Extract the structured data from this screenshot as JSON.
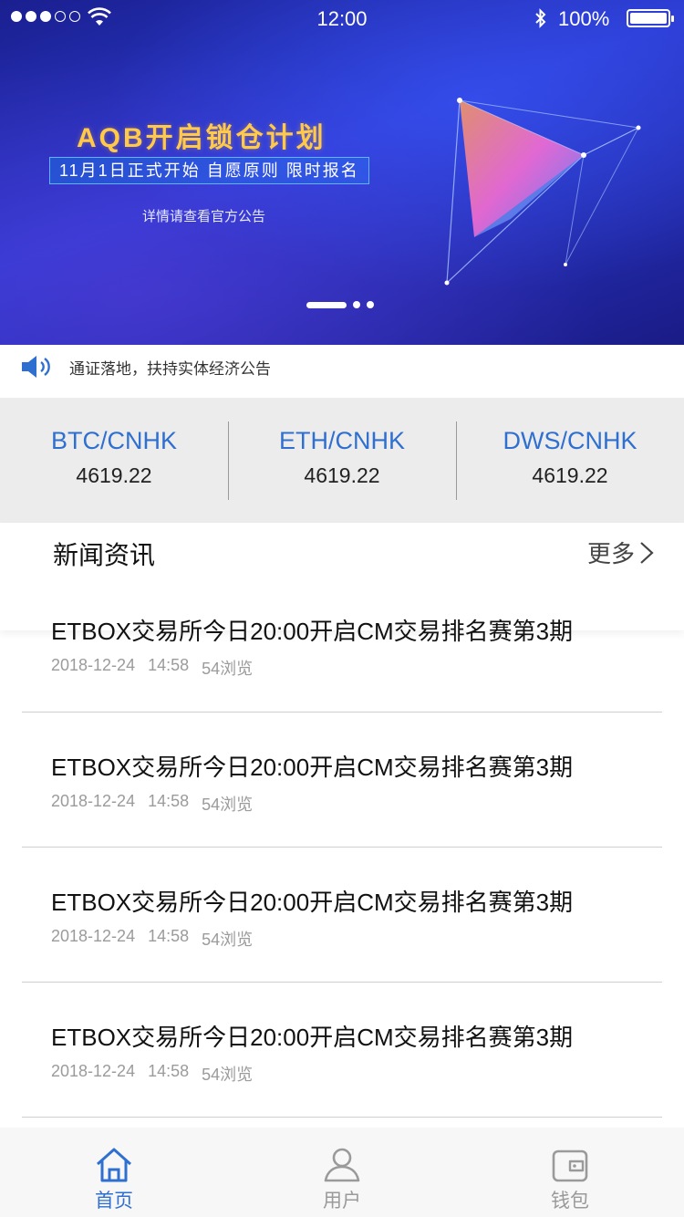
{
  "status_bar": {
    "time": "12:00",
    "battery": "100%"
  },
  "banner": {
    "title": "AQB开启锁仓计划",
    "subtitle": "11月1日正式开始 自愿原则 限时报名",
    "note": "详情请查看官方公告",
    "page_count": 3,
    "active_page": 1
  },
  "notice": {
    "text": "通证落地，扶持实体经济公告"
  },
  "tickers": [
    {
      "pair": "BTC/CNHK",
      "price": "4619.22"
    },
    {
      "pair": "ETH/CNHK",
      "price": "4619.22"
    },
    {
      "pair": "DWS/CNHK",
      "price": "4619.22"
    }
  ],
  "news": {
    "title": "新闻资讯",
    "more_label": "更多",
    "items": [
      {
        "headline": "ETBOX交易所今日20:00开启CM交易排名赛第3期",
        "date": "2018-12-24",
        "time": "14:58",
        "views": "54浏览"
      },
      {
        "headline": "ETBOX交易所今日20:00开启CM交易排名赛第3期",
        "date": "2018-12-24",
        "time": "14:58",
        "views": "54浏览"
      },
      {
        "headline": "ETBOX交易所今日20:00开启CM交易排名赛第3期",
        "date": "2018-12-24",
        "time": "14:58",
        "views": "54浏览"
      },
      {
        "headline": "ETBOX交易所今日20:00开启CM交易排名赛第3期",
        "date": "2018-12-24",
        "time": "14:58",
        "views": "54浏览"
      }
    ]
  },
  "tabbar": {
    "items": [
      {
        "label": "首页",
        "icon": "home-icon",
        "active": true
      },
      {
        "label": "用户",
        "icon": "user-icon",
        "active": false
      },
      {
        "label": "钱包",
        "icon": "wallet-icon",
        "active": false
      }
    ]
  },
  "colors": {
    "accent": "#2f6fd0",
    "banner_gold": "#ffc94a",
    "ticker_bg": "#ececec",
    "inactive": "#9a9a9a"
  }
}
